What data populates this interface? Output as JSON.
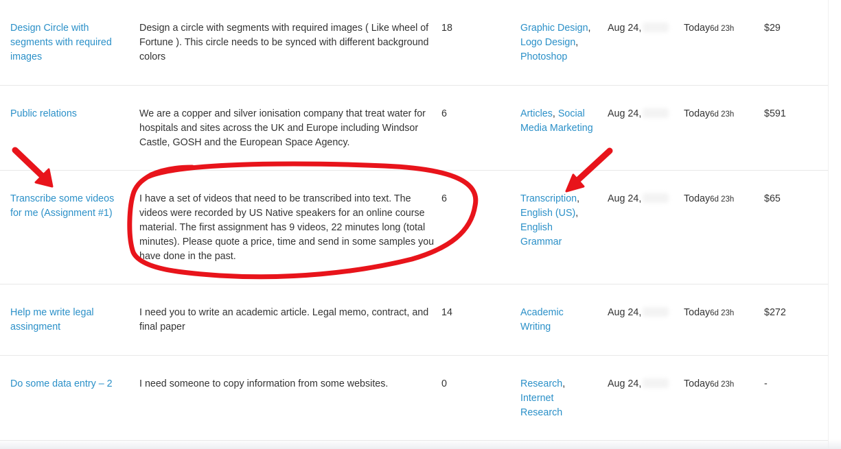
{
  "rows": [
    {
      "title": "Design Circle with segments with required images",
      "description": "Design a circle with segments with required images ( Like wheel of Fortune ). This circle needs to be synced with different background colors",
      "bids": "18",
      "skills": [
        "Graphic Design",
        "Logo Design",
        "Photoshop"
      ],
      "date": "Aug 24,",
      "ends_main": "Today",
      "ends_small": "6d 23h",
      "budget": "$29"
    },
    {
      "title": "Public relations",
      "description": "We are a copper and silver ionisation company that treat water for hospitals and sites across the UK and Europe including Windsor Castle, GOSH and the European Space Agency.",
      "bids": "6",
      "skills": [
        "Articles",
        "Social Media Marketing"
      ],
      "date": "Aug 24,",
      "ends_main": "Today",
      "ends_small": "6d 23h",
      "budget": "$591"
    },
    {
      "title": "Transcribe some videos for me (Assignment #1)",
      "description": "I have a set of videos that need to be transcribed into text. The videos were recorded by US Native speakers for an online course material. The first assignment has 9 videos, 22 minutes long (total minutes). Please quote a price, time and send in some samples you have done in the past.",
      "bids": "6",
      "skills": [
        "Transcription",
        "English (US)",
        "English Grammar"
      ],
      "date": "Aug 24,",
      "ends_main": "Today",
      "ends_small": "6d 23h",
      "budget": "$65"
    },
    {
      "title": "Help me write legal assingment",
      "description": "I need you to write an academic article. Legal memo, contract, and final paper",
      "bids": "14",
      "skills": [
        "Academic Writing"
      ],
      "date": "Aug 24,",
      "ends_main": "Today",
      "ends_small": "6d 23h",
      "budget": "$272"
    },
    {
      "title": "Do some data entry – 2",
      "description": "I need someone to copy information from some websites.",
      "bids": "0",
      "skills": [
        "Research",
        "Internet Research"
      ],
      "date": "Aug 24,",
      "ends_main": "Today",
      "ends_small": "6d 23h",
      "budget": "-"
    }
  ],
  "annotations": {
    "arrow_color": "#e8141b",
    "circle_color": "#e8141b"
  }
}
